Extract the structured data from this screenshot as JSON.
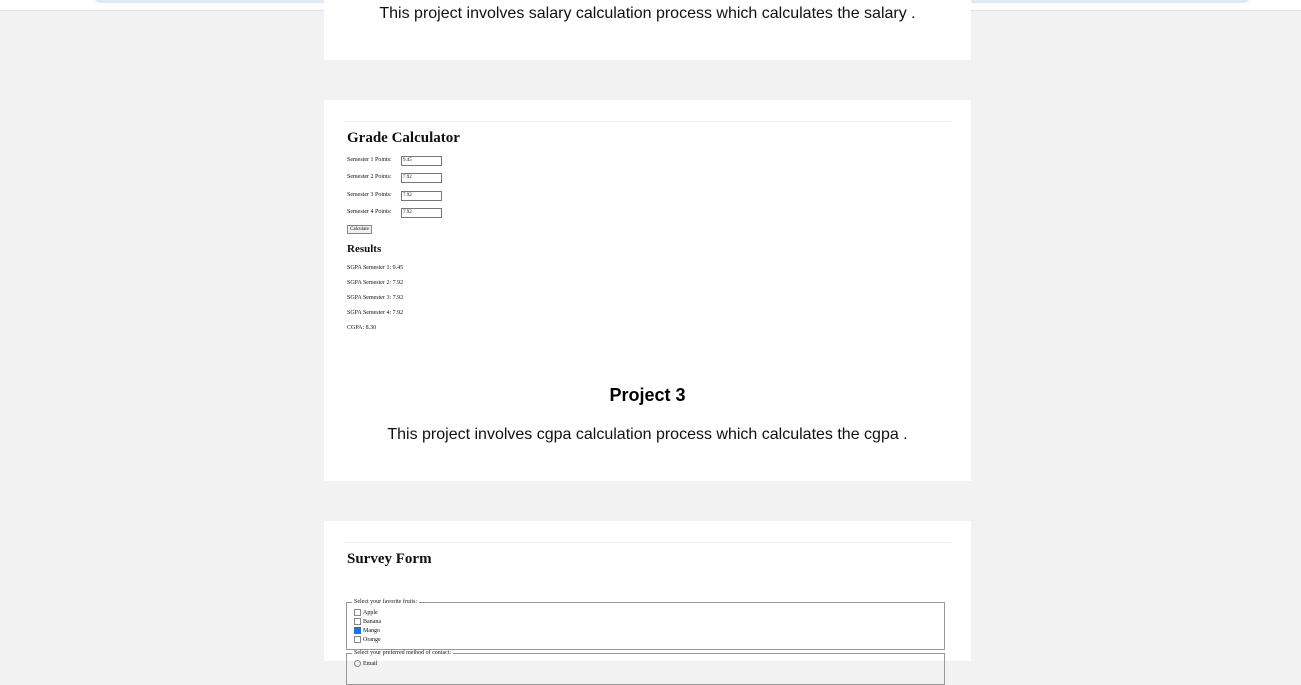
{
  "project2": {
    "description": "This project involves salary calculation process which calculates the salary ."
  },
  "project3": {
    "title": "Project 3",
    "description": "This project involves cgpa calculation process which calculates the cgpa .",
    "preview": {
      "title": "Grade Calculator",
      "fields": [
        {
          "label": "Semester 1 Points:",
          "value": "9.45"
        },
        {
          "label": "Semester 2 Points:",
          "value": "7.92"
        },
        {
          "label": "Semester 3 Points:",
          "value": "7.92"
        },
        {
          "label": "Semester 4 Points:",
          "value": "7.92"
        }
      ],
      "button": "Calculate",
      "results_heading": "Results",
      "results": [
        "SGPA Semester 1: 9.45",
        "SGPA Semester 2: 7.92",
        "SGPA Semester 3: 7.92",
        "SGPA Semester 4: 7.92",
        "CGPA: 8.30"
      ]
    }
  },
  "project4": {
    "preview": {
      "title": "Survey Form",
      "fruits_legend": "Select your favorite fruits:",
      "fruits": [
        {
          "label": "Apple",
          "checked": false
        },
        {
          "label": "Banana",
          "checked": false
        },
        {
          "label": "Mango",
          "checked": true
        },
        {
          "label": "Orange",
          "checked": false
        }
      ],
      "contact_legend": "Select your preferred method of contact:",
      "contact_options": [
        "Email"
      ]
    }
  }
}
